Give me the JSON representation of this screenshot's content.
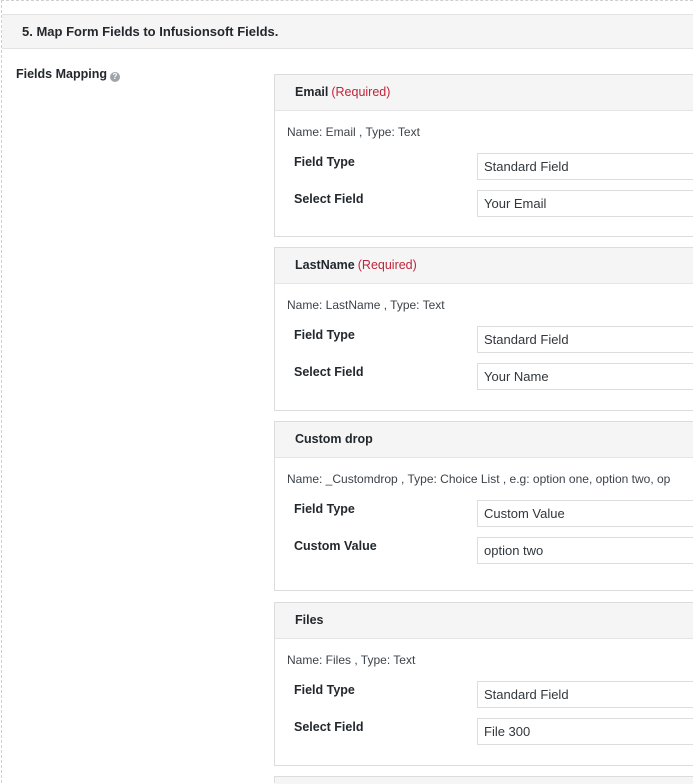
{
  "section": {
    "title": "5. Map Form Fields to Infusionsoft Fields."
  },
  "fields_mapping": {
    "label": "Fields Mapping",
    "help_icon": "question-circle-icon"
  },
  "cards": [
    {
      "name": "Email",
      "required_text": "(Required)",
      "info": "Name: Email , Type: Text",
      "row1_label": "Field Type",
      "row1_value": "Standard Field",
      "row2_label": "Select Field",
      "row2_value": "Your Email"
    },
    {
      "name": "LastName",
      "required_text": "(Required)",
      "info": "Name: LastName , Type: Text",
      "row1_label": "Field Type",
      "row1_value": "Standard Field",
      "row2_label": "Select Field",
      "row2_value": "Your Name"
    },
    {
      "name": "Custom drop",
      "required_text": "",
      "info": "Name: _Customdrop , Type: Choice List , e.g: option one, option two, op",
      "row1_label": "Field Type",
      "row1_value": "Custom Value",
      "row2_label": "Custom Value",
      "row2_value": "option two"
    },
    {
      "name": "Files",
      "required_text": "",
      "info": "Name: Files , Type: Text",
      "row1_label": "Field Type",
      "row1_value": "Standard Field",
      "row2_label": "Select Field",
      "row2_value": "File 300"
    }
  ],
  "colors": {
    "required": "#c0243a",
    "header_bg": "#f5f5f5",
    "border": "#dcdcdc"
  }
}
